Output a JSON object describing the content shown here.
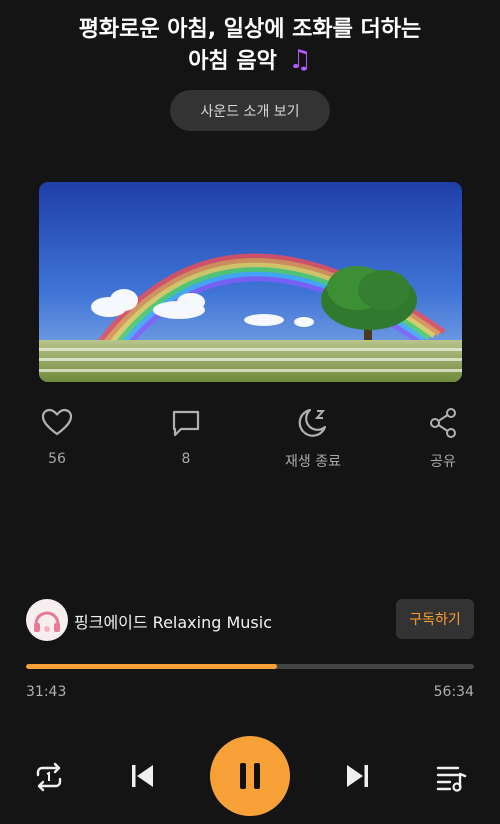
{
  "header": {
    "title_line1": "평화로운 아침, 일상에 조화를 더하는",
    "title_line2": "아침 음악",
    "title_emoji": "♫"
  },
  "intro_button_label": "사운드 소개 보기",
  "artwork": {
    "description_icon": "rainbow-landscape-image"
  },
  "actions": [
    {
      "icon": "heart-icon",
      "label": "56"
    },
    {
      "icon": "comment-icon",
      "label": "8"
    },
    {
      "icon": "sleep-timer-icon",
      "label": "재생 종료"
    },
    {
      "icon": "share-icon",
      "label": "공유"
    }
  ],
  "channel": {
    "name": "핑크에이드 Relaxing Music",
    "subscribe_label": "구독하기"
  },
  "player": {
    "elapsed": "31:43",
    "total": "56:34",
    "progress_fraction": 0.561,
    "accent_color": "#f7a138"
  },
  "controls": {
    "repeat_icon": "repeat-icon",
    "previous_icon": "skip-previous-icon",
    "play_pause_icon": "pause-icon",
    "next_icon": "skip-next-icon",
    "playlist_icon": "playlist-icon"
  }
}
